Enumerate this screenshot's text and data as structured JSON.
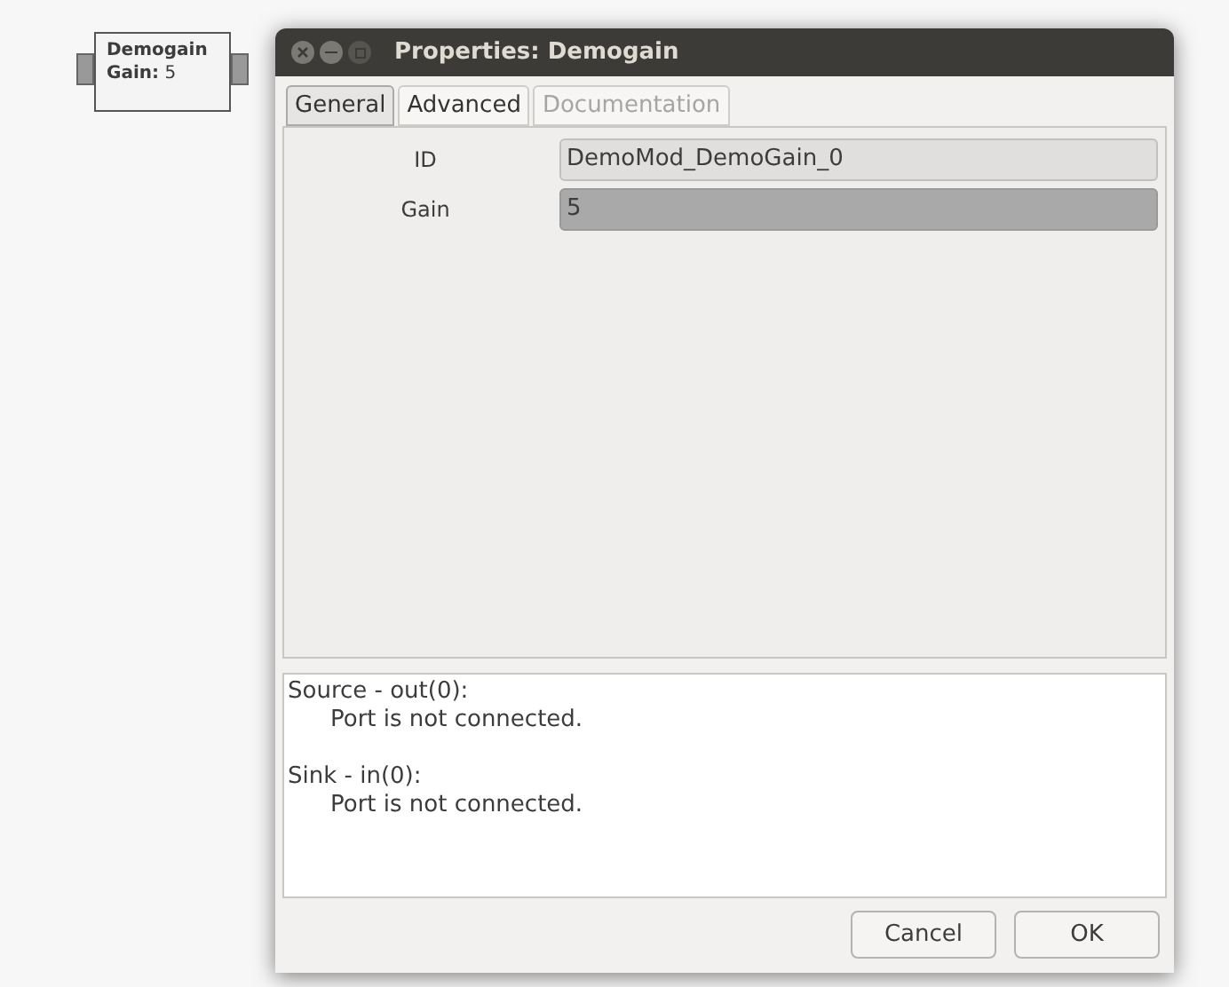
{
  "block": {
    "title": "Demogain",
    "param": "**Gain:** 5"
  },
  "window": {
    "title": "Properties: Demogain"
  },
  "tabs": [
    {
      "label": "General",
      "selected": true,
      "disabled": false
    },
    {
      "label": "Advanced",
      "selected": false,
      "disabled": false
    },
    {
      "label": "Documentation",
      "selected": false,
      "disabled": true
    }
  ],
  "fields": [
    {
      "label": "ID",
      "value": "DemoMod_DemoGain_0",
      "highlighted": false
    },
    {
      "label": "Gain",
      "value": "5",
      "highlighted": true
    }
  ],
  "messages": [
    {
      "heading": "Source - out(0):",
      "text": "Port is not connected."
    },
    {
      "heading": "Sink - in(0):",
      "text": "Port is not connected."
    }
  ],
  "buttons": [
    "Cancel",
    "OK"
  ]
}
